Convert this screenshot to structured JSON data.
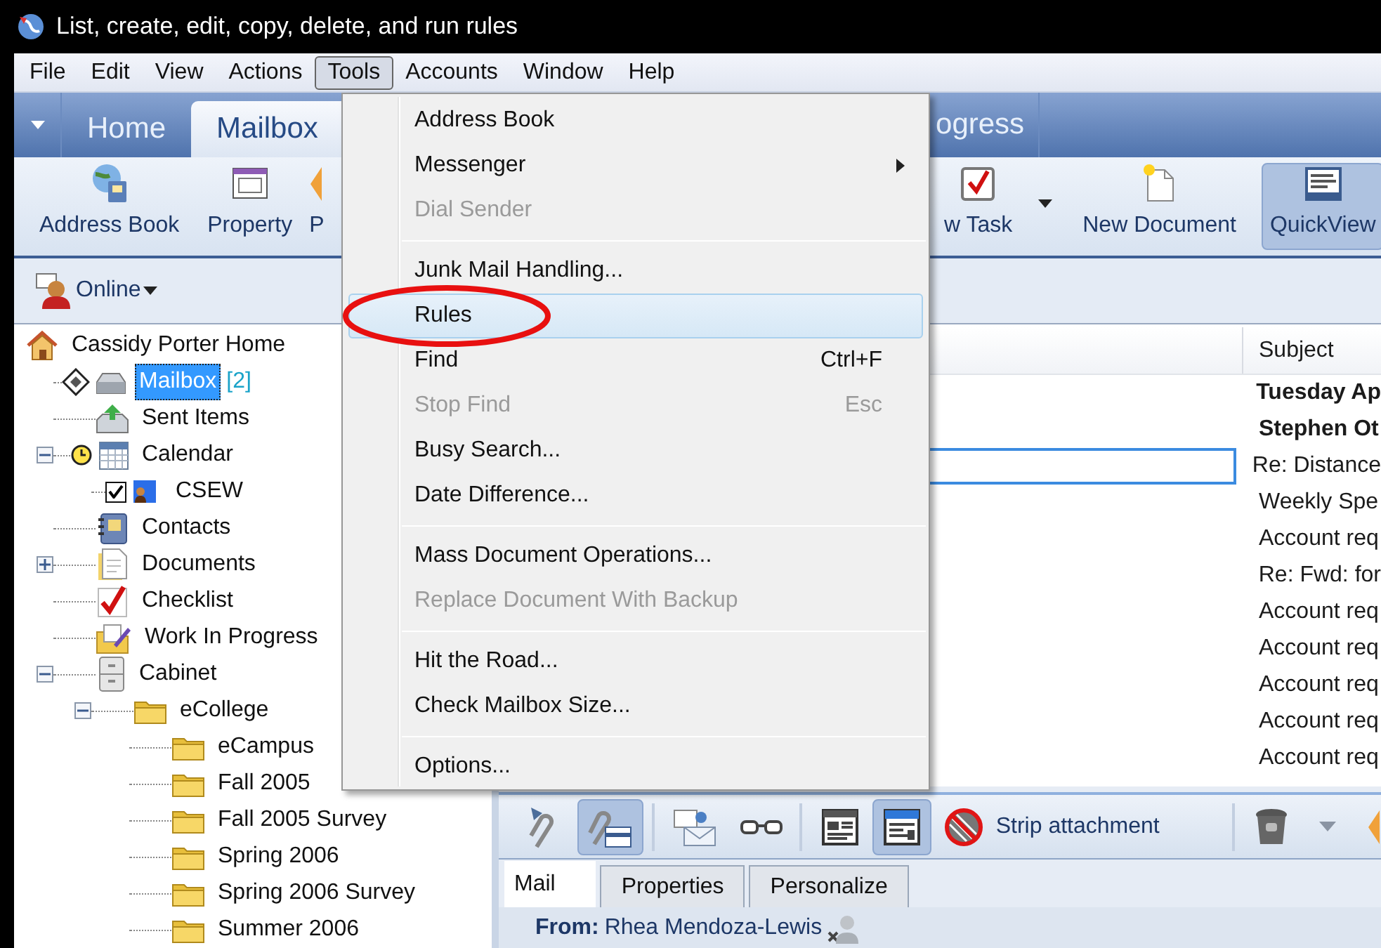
{
  "window": {
    "title": "List, create, edit, copy, delete, and run rules"
  },
  "menu_bar": [
    {
      "label": "File",
      "selected": false
    },
    {
      "label": "Edit",
      "selected": false
    },
    {
      "label": "View",
      "selected": false
    },
    {
      "label": "Actions",
      "selected": false
    },
    {
      "label": "Tools",
      "selected": true
    },
    {
      "label": "Accounts",
      "selected": false
    },
    {
      "label": "Window",
      "selected": false
    },
    {
      "label": "Help",
      "selected": false
    }
  ],
  "tools_menu": [
    {
      "kind": "item",
      "label": "Address Book",
      "disabled": false,
      "submenu": false,
      "highlighted": false,
      "circled": false
    },
    {
      "kind": "item",
      "label": "Messenger",
      "disabled": false,
      "submenu": true,
      "highlighted": false,
      "circled": false
    },
    {
      "kind": "item",
      "label": "Dial Sender",
      "disabled": true,
      "submenu": false,
      "highlighted": false,
      "circled": false
    },
    {
      "kind": "separator"
    },
    {
      "kind": "item",
      "label": "Junk Mail Handling...",
      "disabled": false,
      "submenu": false,
      "highlighted": false,
      "circled": false
    },
    {
      "kind": "item",
      "label": "Rules",
      "disabled": false,
      "submenu": false,
      "highlighted": true,
      "circled": true
    },
    {
      "kind": "item",
      "label": "Find",
      "shortcut": "Ctrl+F",
      "disabled": false,
      "submenu": false,
      "highlighted": false,
      "circled": false
    },
    {
      "kind": "item",
      "label": "Stop Find",
      "shortcut": "Esc",
      "disabled": true,
      "submenu": false,
      "highlighted": false,
      "circled": false
    },
    {
      "kind": "item",
      "label": "Busy Search...",
      "disabled": false,
      "submenu": false,
      "highlighted": false,
      "circled": false
    },
    {
      "kind": "item",
      "label": "Date Difference...",
      "disabled": false,
      "submenu": false,
      "highlighted": false,
      "circled": false
    },
    {
      "kind": "separator"
    },
    {
      "kind": "item",
      "label": "Mass Document Operations...",
      "disabled": false,
      "submenu": false,
      "highlighted": false,
      "circled": false
    },
    {
      "kind": "item",
      "label": "Replace Document With Backup",
      "disabled": true,
      "submenu": false,
      "highlighted": false,
      "circled": false
    },
    {
      "kind": "separator"
    },
    {
      "kind": "item",
      "label": "Hit the Road...",
      "disabled": false,
      "submenu": false,
      "highlighted": false,
      "circled": false
    },
    {
      "kind": "item",
      "label": "Check Mailbox Size...",
      "disabled": false,
      "submenu": false,
      "highlighted": false,
      "circled": false
    },
    {
      "kind": "separator"
    },
    {
      "kind": "item",
      "label": "Options...",
      "disabled": false,
      "submenu": false,
      "highlighted": false,
      "circled": false
    }
  ],
  "ribbon_tabs": [
    {
      "label": "Home",
      "selected": false
    },
    {
      "label": "Mailbox",
      "selected": true
    },
    {
      "label": "ogress",
      "selected": false
    }
  ],
  "toolbar": [
    {
      "kind": "address-book",
      "label": "Address Book",
      "pressed": false,
      "dropdown": false
    },
    {
      "kind": "property",
      "label": "Property",
      "pressed": false,
      "dropdown": false
    },
    {
      "kind": "partial",
      "label": "P",
      "pressed": false,
      "dropdown": false
    },
    {
      "kind": "task",
      "label": "w Task",
      "pressed": false,
      "dropdown": true
    },
    {
      "kind": "document",
      "label": "New Document",
      "pressed": false,
      "dropdown": false
    },
    {
      "kind": "quickview",
      "label": "QuickView",
      "pressed": true,
      "dropdown": false
    }
  ],
  "presence": {
    "label": "Online"
  },
  "folder_tree": [
    {
      "kind": "home",
      "label": "Cassidy Porter Home",
      "selected": false,
      "children": [
        {
          "kind": "inbox",
          "label": "Mailbox",
          "count": "[2]",
          "selected": true
        },
        {
          "kind": "sent",
          "label": "Sent Items",
          "selected": false
        },
        {
          "kind": "calendar",
          "label": "Calendar",
          "selected": false,
          "expanded": true,
          "children": [
            {
              "kind": "shared-calendar",
              "label": "CSEW",
              "selected": false,
              "checked": true
            }
          ]
        },
        {
          "kind": "contacts",
          "label": "Contacts",
          "selected": false
        },
        {
          "kind": "documents",
          "label": "Documents",
          "selected": false,
          "expanded": false
        },
        {
          "kind": "checklist",
          "label": "Checklist",
          "selected": false
        },
        {
          "kind": "work",
          "label": "Work In Progress",
          "selected": false
        },
        {
          "kind": "cabinet",
          "label": "Cabinet",
          "selected": false,
          "expanded": true,
          "children": [
            {
              "kind": "folder",
              "label": "eCollege",
              "selected": false,
              "expanded": true,
              "children": [
                {
                  "kind": "folder",
                  "label": "eCampus",
                  "selected": false
                },
                {
                  "kind": "folder",
                  "label": "Fall 2005",
                  "selected": false
                },
                {
                  "kind": "folder",
                  "label": "Fall 2005 Survey",
                  "selected": false
                },
                {
                  "kind": "folder",
                  "label": "Spring 2006",
                  "selected": false
                },
                {
                  "kind": "folder",
                  "label": "Spring 2006 Survey",
                  "selected": false
                },
                {
                  "kind": "folder",
                  "label": "Summer 2006",
                  "selected": false
                }
              ]
            }
          ]
        }
      ]
    }
  ],
  "message_list": {
    "columns": [
      "Subject"
    ],
    "rows": [
      {
        "subject": "Tuesday Ap",
        "unread": true,
        "focused": false
      },
      {
        "subject": "Stephen Ot",
        "unread": true,
        "focused": false
      },
      {
        "subject": "Re: Distance",
        "unread": false,
        "focused": true
      },
      {
        "subject": "Weekly Spe",
        "unread": false,
        "focused": false
      },
      {
        "subject": "Account req",
        "unread": false,
        "focused": false
      },
      {
        "subject": "Re: Fwd: for",
        "unread": false,
        "focused": false
      },
      {
        "subject": "Account req",
        "unread": false,
        "focused": false
      },
      {
        "subject": "Account req",
        "unread": false,
        "focused": false
      },
      {
        "subject": "Account req",
        "unread": false,
        "focused": false
      },
      {
        "subject": "Account req",
        "unread": false,
        "focused": false
      },
      {
        "subject": "Account req",
        "unread": false,
        "focused": false
      }
    ]
  },
  "preview": {
    "toolbar": [
      {
        "kind": "reattach",
        "pressed": false
      },
      {
        "kind": "attach-window",
        "pressed": true
      },
      {
        "kind": "separator"
      },
      {
        "kind": "envelope",
        "pressed": false
      },
      {
        "kind": "glasses",
        "pressed": false
      },
      {
        "kind": "separator"
      },
      {
        "kind": "layout",
        "pressed": false
      },
      {
        "kind": "layout-blue",
        "pressed": true
      },
      {
        "kind": "strip",
        "label": "Strip attachment",
        "pressed": false
      },
      {
        "kind": "separator"
      },
      {
        "kind": "trash",
        "pressed": false
      },
      {
        "kind": "caret",
        "pressed": false
      },
      {
        "kind": "partial",
        "pressed": false
      }
    ],
    "tabs": [
      {
        "label": "Mail",
        "selected": true
      },
      {
        "label": "Properties",
        "selected": false
      },
      {
        "label": "Personalize",
        "selected": false
      }
    ],
    "from": {
      "label": "From:",
      "name": "Rhea Mendoza-Lewis"
    }
  }
}
